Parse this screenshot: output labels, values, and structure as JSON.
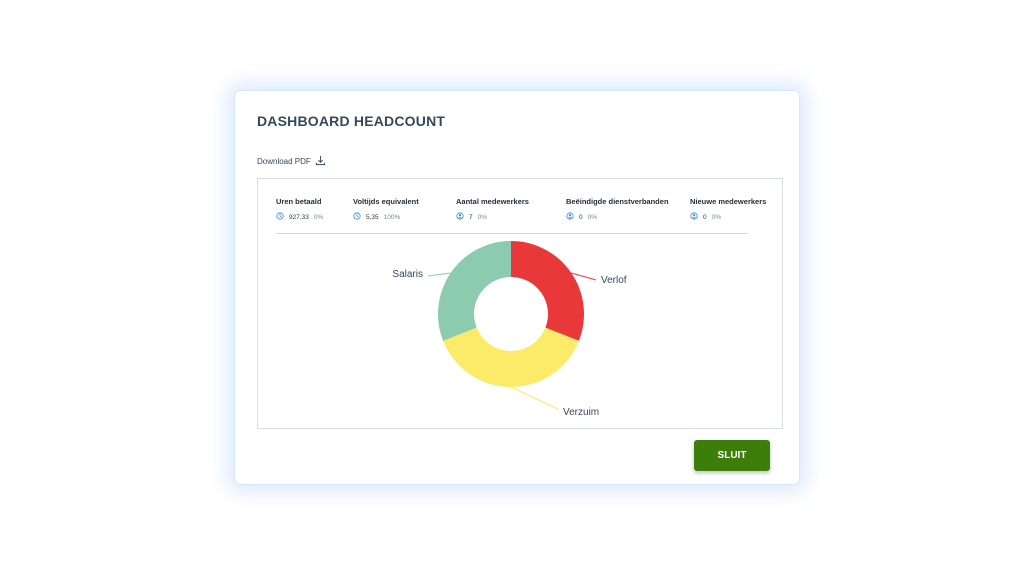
{
  "dialog": {
    "title": "DASHBOARD HEADCOUNT",
    "download_label": "Download PDF",
    "close_label": "SLUIT"
  },
  "stats": [
    {
      "label": "Uren betaald",
      "icon": "clock-icon",
      "value": "927,33",
      "percent": "0%"
    },
    {
      "label": "Voltijds equivalent",
      "icon": "clock-icon",
      "value": "5,35",
      "percent": "100%"
    },
    {
      "label": "Aantal medewerkers",
      "icon": "user-circle-icon",
      "value": "7",
      "percent": "0%"
    },
    {
      "label": "Beëindigde dienstverbanden",
      "icon": "user-circle-icon",
      "value": "0",
      "percent": "0%"
    },
    {
      "label": "Nieuwe medewerkers",
      "icon": "user-circle-icon",
      "value": "0",
      "percent": "0%"
    }
  ],
  "colors": {
    "accent_button": "#3d7d0a",
    "icon_blue": "#2a8dd4",
    "verlof": "#e8383a",
    "verzuim": "#fbeb68",
    "salaris": "#8ccbb0"
  },
  "chart_data": {
    "type": "pie",
    "style": "donut",
    "categories": [
      "Verlof",
      "Verzuim",
      "Salaris"
    ],
    "values": [
      31,
      38,
      31
    ],
    "colors": [
      "#e8383a",
      "#fbeb68",
      "#8ccbb0"
    ]
  }
}
